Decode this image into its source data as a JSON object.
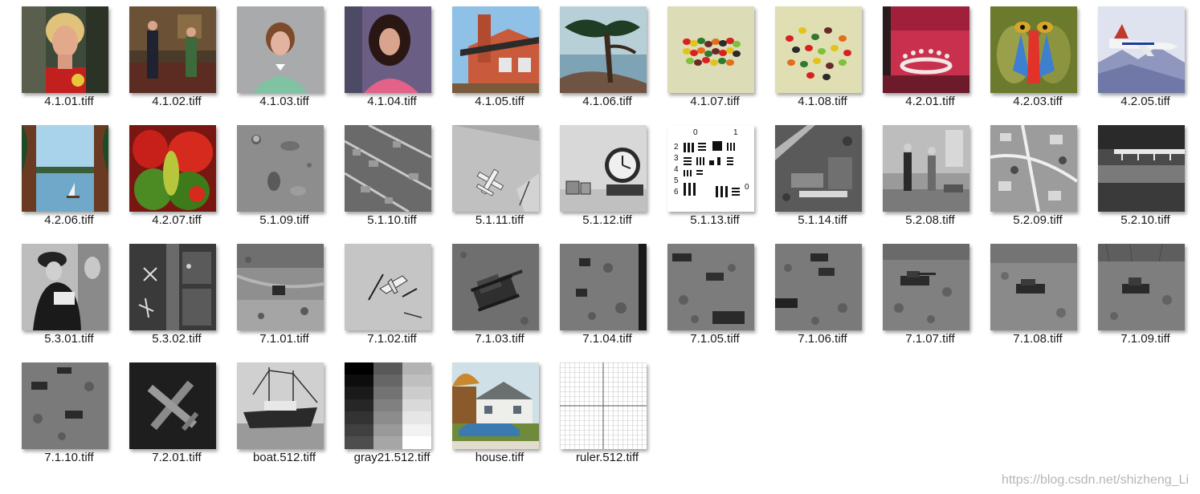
{
  "files": [
    {
      "name": "4.1.01.tiff",
      "icon": "portrait-woman-red-icon"
    },
    {
      "name": "4.1.02.tiff",
      "icon": "couple-living-room-icon"
    },
    {
      "name": "4.1.03.tiff",
      "icon": "portrait-woman-green-icon"
    },
    {
      "name": "4.1.04.tiff",
      "icon": "portrait-girl-pink-icon"
    },
    {
      "name": "4.1.05.tiff",
      "icon": "brick-house-icon"
    },
    {
      "name": "4.1.06.tiff",
      "icon": "cypress-tree-icon"
    },
    {
      "name": "4.1.07.tiff",
      "icon": "jelly-beans-icon"
    },
    {
      "name": "4.1.08.tiff",
      "icon": "jelly-beans-scattered-icon"
    },
    {
      "name": "4.2.01.tiff",
      "icon": "milk-splash-icon"
    },
    {
      "name": "4.2.03.tiff",
      "icon": "mandrill-icon"
    },
    {
      "name": "4.2.05.tiff",
      "icon": "jet-airplane-icon"
    },
    {
      "name": "4.2.06.tiff",
      "icon": "lake-sailboat-icon"
    },
    {
      "name": "4.2.07.tiff",
      "icon": "peppers-icon"
    },
    {
      "name": "5.1.09.tiff",
      "icon": "moon-surface-icon"
    },
    {
      "name": "5.1.10.tiff",
      "icon": "aerial-city-icon"
    },
    {
      "name": "5.1.11.tiff",
      "icon": "aerial-airplane-icon"
    },
    {
      "name": "5.1.12.tiff",
      "icon": "clock-icon"
    },
    {
      "name": "5.1.13.tiff",
      "icon": "resolution-chart-icon"
    },
    {
      "name": "5.1.14.tiff",
      "icon": "aerial-industrial-icon"
    },
    {
      "name": "5.2.08.tiff",
      "icon": "couple-gray-icon"
    },
    {
      "name": "5.2.09.tiff",
      "icon": "aerial-suburb-icon"
    },
    {
      "name": "5.2.10.tiff",
      "icon": "bridge-stream-icon"
    },
    {
      "name": "5.3.01.tiff",
      "icon": "man-seated-icon"
    },
    {
      "name": "5.3.02.tiff",
      "icon": "aerial-airport-icon"
    },
    {
      "name": "7.1.01.tiff",
      "icon": "truck-desert-icon"
    },
    {
      "name": "7.1.02.tiff",
      "icon": "aircraft-desert-icon"
    },
    {
      "name": "7.1.03.tiff",
      "icon": "tank-icon"
    },
    {
      "name": "7.1.04.tiff",
      "icon": "vehicles-desert-icon"
    },
    {
      "name": "7.1.05.tiff",
      "icon": "trucks-desert-icon"
    },
    {
      "name": "7.1.06.tiff",
      "icon": "trucks-desert-2-icon"
    },
    {
      "name": "7.1.07.tiff",
      "icon": "tank-desert-icon"
    },
    {
      "name": "7.1.08.tiff",
      "icon": "apc-desert-icon"
    },
    {
      "name": "7.1.09.tiff",
      "icon": "tank-desert-2-icon"
    },
    {
      "name": "7.1.10.tiff",
      "icon": "vehicles-desert-2-icon"
    },
    {
      "name": "7.2.01.tiff",
      "icon": "airplane-dark-icon"
    },
    {
      "name": "boat.512.tiff",
      "icon": "boat-icon"
    },
    {
      "name": "gray21.512.tiff",
      "icon": "gray-steps-icon"
    },
    {
      "name": "house.tiff",
      "icon": "house-car-icon"
    },
    {
      "name": "ruler.512.tiff",
      "icon": "ruler-grid-icon"
    }
  ],
  "watermark": "https://blog.csdn.net/shizheng_Li"
}
